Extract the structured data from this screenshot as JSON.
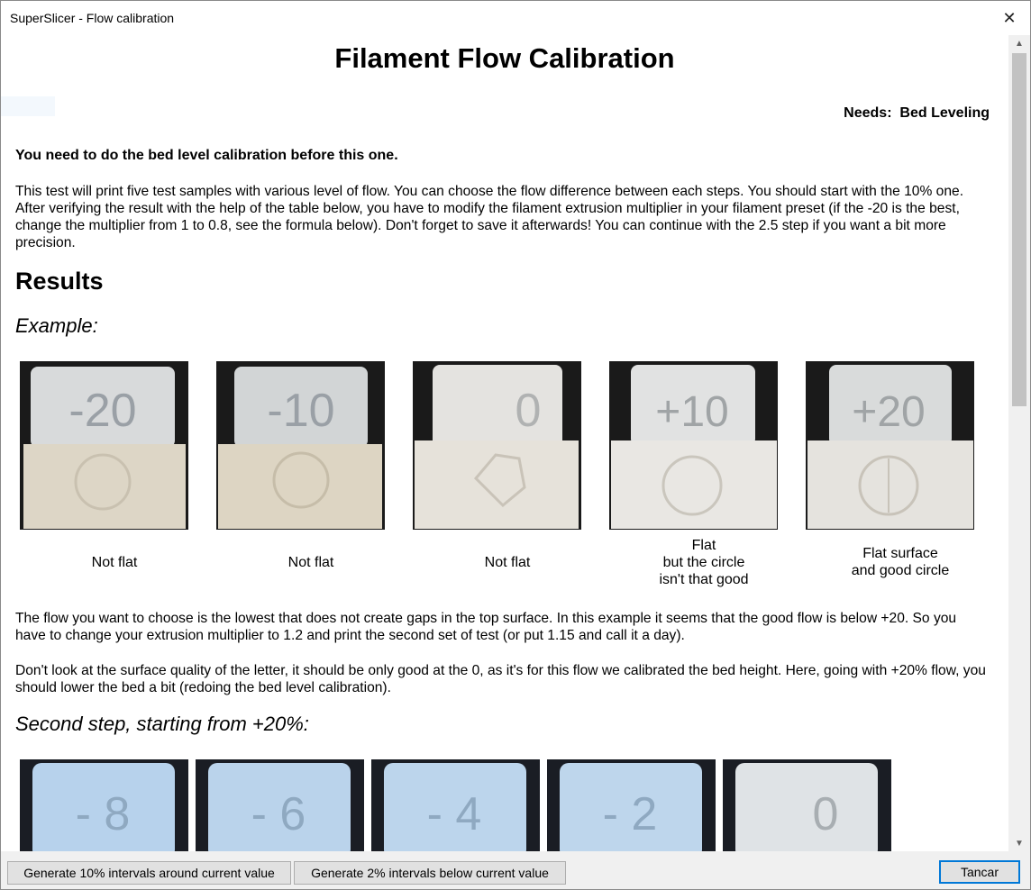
{
  "window": {
    "title": "SuperSlicer - Flow calibration"
  },
  "page": {
    "heading": "Filament Flow Calibration",
    "needs_label": "Needs:",
    "needs_value": "Bed Leveling",
    "warning": "You need to do the bed level calibration before this one.",
    "intro": "This test will print five test samples with various level of flow. You can choose the flow difference between each steps. You should start with the 10% one. After verifying the result with the help of the table below, you have to modify the filament extrusion multiplier in your filament preset (if the -20 is the best, change the multiplier from 1 to 0.8, see the formula below). Don't forget to save it afterwards! You can continue with the 2.5 step if you want a bit more precision.",
    "results_heading": "Results",
    "example_heading": "Example:",
    "samples": [
      {
        "label": "-20",
        "caption": [
          "Not flat"
        ]
      },
      {
        "label": "-10",
        "caption": [
          "Not flat"
        ]
      },
      {
        "label": "0",
        "caption": [
          "Not flat"
        ]
      },
      {
        "label": "+10",
        "caption": [
          "Flat",
          "but the circle",
          "isn't that good"
        ]
      },
      {
        "label": "+20",
        "caption": [
          "Flat surface",
          "and good circle"
        ]
      }
    ],
    "para_choose": "The flow you want to choose is the lowest that does not create gaps in the top surface. In this example it seems that the good flow is below +20. So you have to change your extrusion multiplier to 1.2 and print the second set of test (or put 1.15 and call it a day).",
    "para_surface": "Don't look at the surface quality of the letter, it should be only good at the 0, as it's for this flow we calibrated the bed height. Here, going with +20% flow, you should lower the bed a bit (redoing the bed level calibration).",
    "second_step_heading": "Second step, starting from +20%:",
    "second_samples": [
      "- 8",
      "- 6",
      "- 4",
      "- 2",
      "0"
    ]
  },
  "footer": {
    "btn_10": "Generate 10% intervals around current value",
    "btn_2": "Generate 2% intervals below current value",
    "btn_close": "Tancar"
  },
  "colors": {
    "default_button_border": "#0078d7",
    "sample_bg": "#1a1a1a",
    "print_white": "#e8e6e0",
    "print_blue": "#b9d3ea"
  }
}
